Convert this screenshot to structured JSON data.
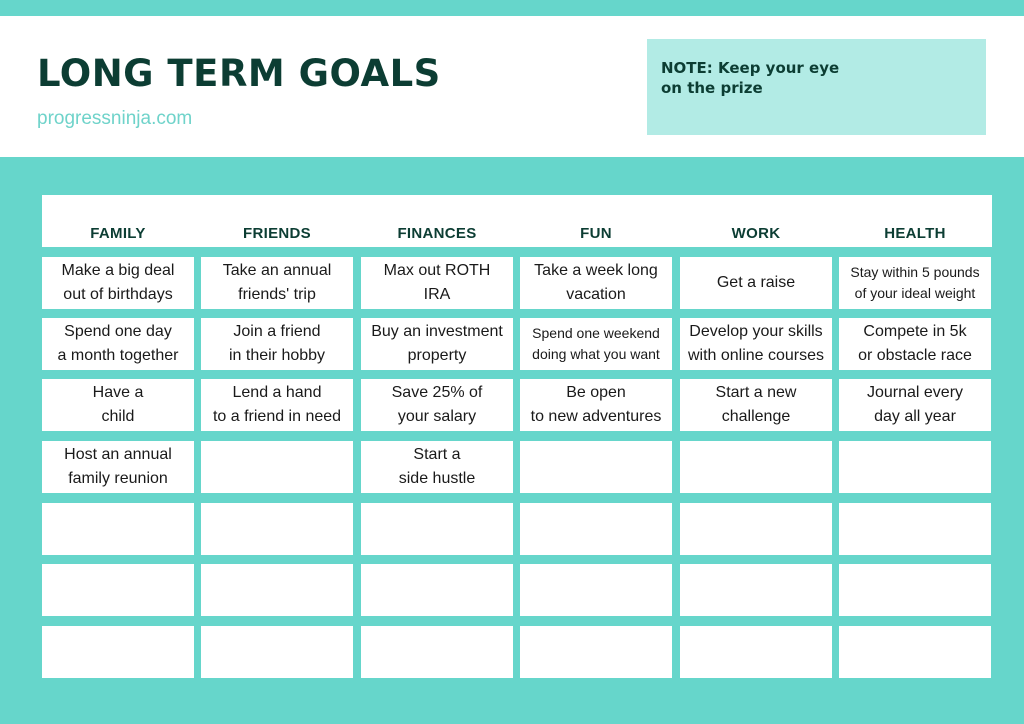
{
  "title": "LONG TERM GOALS",
  "site": "progressninja.com",
  "note": "NOTE: Keep your eye\non the prize",
  "columns": [
    "FAMILY",
    "FRIENDS",
    "FINANCES",
    "FUN",
    "WORK",
    "HEALTH"
  ],
  "rows": [
    [
      "Make a big deal\nout of birthdays",
      "Take an annual\nfriends' trip",
      "Max out ROTH\nIRA",
      "Take a week long\nvacation",
      "Get a raise",
      "Stay within 5 pounds\nof your ideal weight"
    ],
    [
      "Spend one day\na month together",
      "Join a friend\nin their hobby",
      "Buy an investment\nproperty",
      "Spend one weekend\ndoing what you want",
      "Develop your skills\nwith online courses",
      "Compete in 5k\nor obstacle race"
    ],
    [
      "Have a\nchild",
      "Lend a hand\nto a friend in need",
      "Save 25% of\nyour salary",
      "Be open\nto new adventures",
      "Start a new\nchallenge",
      "Journal every\nday all year"
    ],
    [
      "Host an annual\nfamily reunion",
      "",
      "Start a\nside hustle",
      "",
      "",
      ""
    ],
    [
      "",
      "",
      "",
      "",
      "",
      ""
    ],
    [
      "",
      "",
      "",
      "",
      "",
      ""
    ],
    [
      "",
      "",
      "",
      "",
      "",
      ""
    ]
  ],
  "colors": {
    "background": "#66d6cb",
    "note_bg": "#b2ebe5",
    "title": "#0c3d33",
    "site": "#6fd3ca"
  }
}
